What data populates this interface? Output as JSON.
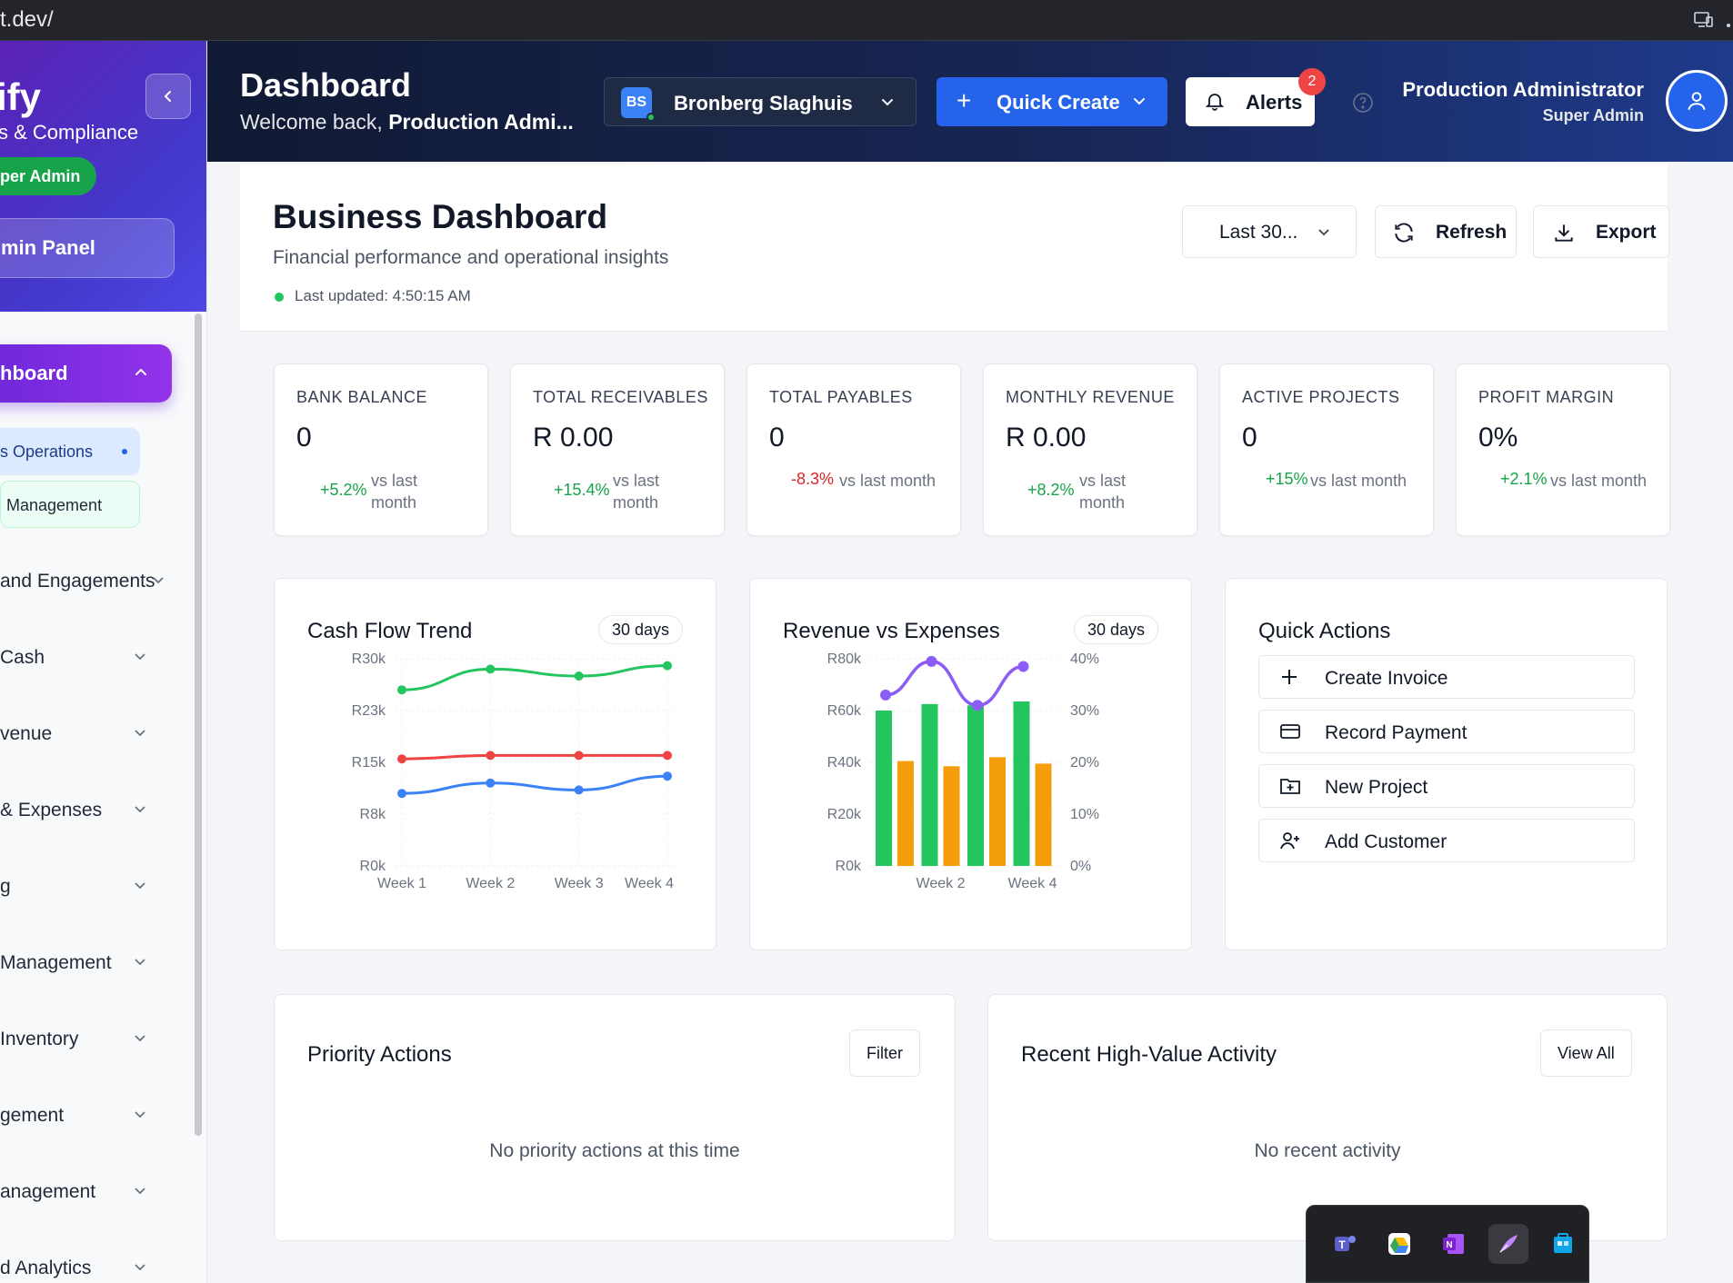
{
  "browser": {
    "url": "t.dev/"
  },
  "sidebar": {
    "brand": "ify",
    "brand_sub": "s & Compliance",
    "role": "per Admin",
    "admin_panel": "min Panel",
    "active_item": "hboard",
    "sub_items": [
      {
        "label": "s Operations"
      },
      {
        "label": "Management"
      }
    ],
    "items": [
      {
        "label": "and Engagements"
      },
      {
        "label": "Cash"
      },
      {
        "label": "venue"
      },
      {
        "label": "& Expenses"
      },
      {
        "label": "g"
      },
      {
        "label": "Management"
      },
      {
        "label": "Inventory"
      },
      {
        "label": "gement"
      },
      {
        "label": "anagement"
      },
      {
        "label": "d Analytics"
      }
    ]
  },
  "header": {
    "title": "Dashboard",
    "welcome_prefix": "Welcome back, ",
    "welcome_name": "Production Admi...",
    "company_initials": "BS",
    "company_name": "Bronberg Slaghuis",
    "quick_create": "Quick Create",
    "alerts_label": "Alerts",
    "alerts_count": "2",
    "user_name": "Production Administrator",
    "user_role": "Super Admin"
  },
  "page": {
    "title": "Business Dashboard",
    "subtitle": "Financial performance and operational insights",
    "last_updated": "Last updated: 4:50:15 AM",
    "range": "Last 30...",
    "refresh": "Refresh",
    "export": "Export"
  },
  "kpis": [
    {
      "label": "BANK BALANCE",
      "value": "0",
      "change": "+5.2%",
      "vs1": "vs last",
      "vs2": "month",
      "trend": "up"
    },
    {
      "label": "TOTAL RECEIVABLES",
      "value": "R 0.00",
      "change": "+15.4%",
      "vs1": "vs last",
      "vs2": "month",
      "trend": "up"
    },
    {
      "label": "TOTAL PAYABLES",
      "value": "0",
      "change": "-8.3%",
      "vs1": "vs last month",
      "vs2": "",
      "trend": "down"
    },
    {
      "label": "MONTHLY REVENUE",
      "value": "R 0.00",
      "change": "+8.2%",
      "vs1": "vs last",
      "vs2": "month",
      "trend": "up"
    },
    {
      "label": "ACTIVE PROJECTS",
      "value": "0",
      "change": "+15%",
      "vs1": "vs last month",
      "vs2": "",
      "trend": "up"
    },
    {
      "label": "PROFIT MARGIN",
      "value": "0%",
      "change": "+2.1%",
      "vs1": "vs last month",
      "vs2": "",
      "trend": "up"
    }
  ],
  "cashflow_card": {
    "title": "Cash Flow Trend",
    "pill": "30 days"
  },
  "revexp_card": {
    "title": "Revenue vs Expenses",
    "pill": "30 days"
  },
  "quick_actions": {
    "title": "Quick Actions",
    "items": [
      {
        "label": "Create Invoice",
        "icon": "plus-icon"
      },
      {
        "label": "Record Payment",
        "icon": "credit-card-icon"
      },
      {
        "label": "New Project",
        "icon": "folder-plus-icon"
      },
      {
        "label": "Add Customer",
        "icon": "user-plus-icon"
      }
    ]
  },
  "priority": {
    "title": "Priority Actions",
    "filter": "Filter",
    "empty": "No priority actions at this time"
  },
  "activity": {
    "title": "Recent High-Value Activity",
    "view_all": "View All",
    "empty": "No recent activity"
  },
  "colors": {
    "green": "#22c55e",
    "red": "#ef4444",
    "blue": "#3b82f6",
    "orange": "#f59e0b",
    "purple": "#8b5cf6",
    "primary": "#2563eb"
  },
  "chart_data": [
    {
      "type": "line",
      "title": "Cash Flow Trend",
      "x": [
        "Week 1",
        "Week 2",
        "Week 3",
        "Week 4"
      ],
      "y_ticks": [
        "R0k",
        "R8k",
        "R15k",
        "R23k",
        "R30k"
      ],
      "ylim": [
        0,
        30000
      ],
      "grid": true,
      "series": [
        {
          "color": "#22c55e",
          "values": [
            25500,
            28500,
            27500,
            29000
          ]
        },
        {
          "color": "#ef4444",
          "values": [
            15500,
            16000,
            16000,
            16000
          ]
        },
        {
          "color": "#3b82f6",
          "values": [
            10500,
            12000,
            11000,
            13000
          ]
        }
      ]
    },
    {
      "type": "bar",
      "title": "Revenue vs Expenses",
      "x_labels": [
        "Week 2",
        "Week 4"
      ],
      "y_ticks": [
        "R0k",
        "R20k",
        "R40k",
        "R60k",
        "R80k"
      ],
      "y2_ticks": [
        "0%",
        "10%",
        "20%",
        "30%",
        "40%"
      ],
      "ylim": [
        0,
        80000
      ],
      "y2lim": [
        0,
        40
      ],
      "grid": true,
      "series": [
        {
          "color": "#22c55e",
          "values": [
            60000,
            62500,
            62000,
            63500
          ]
        },
        {
          "color": "#f59e0b",
          "values": [
            40500,
            38500,
            42000,
            39500
          ]
        },
        {
          "color": "#8b5cf6",
          "axis": "right",
          "values": [
            33,
            39.5,
            31,
            38.5
          ]
        }
      ]
    }
  ],
  "dock": {
    "icons": [
      "teams-icon",
      "drive-icon",
      "onenote-icon",
      "quill-icon",
      "store-icon"
    ]
  }
}
